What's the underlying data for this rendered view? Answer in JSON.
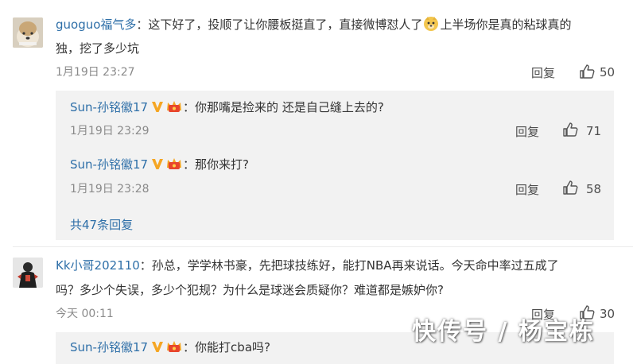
{
  "comments": [
    {
      "username": "guoguo福气多",
      "text_line1_a": "：这下好了，投顺了让你腰板挺直了，直接微博怼人了",
      "emoji": "doge-emoji",
      "text_line1_b": "上半场你是真的粘球真的",
      "text_line2": "独，挖了多少坑",
      "time": "1月19日 23:27",
      "reply_label": "回复",
      "likes": "50",
      "replies": [
        {
          "username": "Sun-孙铭徽17",
          "text": "：你那嘴是捡来的 还是自己缝上去的?",
          "time": "1月19日 23:29",
          "reply_label": "回复",
          "likes": "71"
        },
        {
          "username": "Sun-孙铭徽17",
          "text": "：那你来打?",
          "time": "1月19日 23:28",
          "reply_label": "回复",
          "likes": "58"
        }
      ],
      "more_replies": "共47条回复"
    },
    {
      "username": "Kk小哥202110",
      "text_line1": "：孙总，学学林书豪，先把球技练好，能打NBA再来说话。今天命中率过五成了",
      "text_line2": "吗？多少个失误，多少个犯规？为什么是球迷会质疑你？难道都是嫉妒你?",
      "time": "今天 00:11",
      "reply_label": "回复",
      "likes": "30",
      "replies": [
        {
          "username": "Sun-孙铭徽17",
          "text": "：你能打cba吗?"
        }
      ]
    }
  ],
  "watermark": "快传号 / 杨宝栋",
  "colors": {
    "username": "#2e6fa8",
    "panel_bg": "#f2f2f2",
    "meta_gray": "#8a8a8a",
    "verified_gold": "#f5a623",
    "vip_red": "#e8452c"
  },
  "icons": {
    "like": "thumbs-up-icon",
    "verified": "verified-v-icon",
    "vip": "vip-crown-icon",
    "emoji": "doge-emoji"
  }
}
